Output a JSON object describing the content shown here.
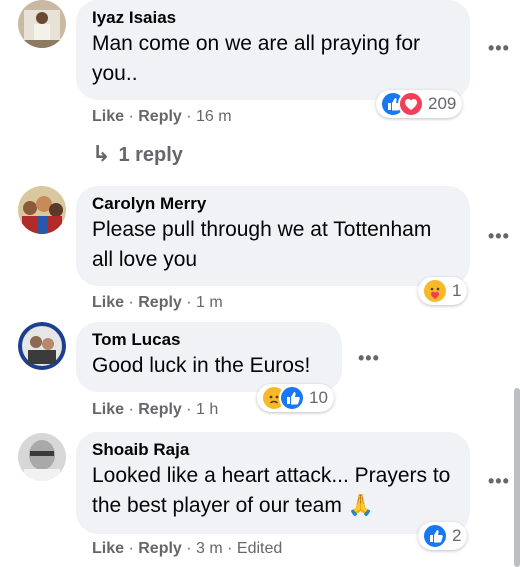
{
  "comments": [
    {
      "author": "Iyaz Isaias",
      "text": "Man come on we are all praying for you..",
      "actions": {
        "like": "Like",
        "sep": " · ",
        "reply": "Reply",
        "time": "16 m"
      },
      "reactions": {
        "icons": [
          "like-icon",
          "love-icon"
        ],
        "count": "209"
      },
      "replies": "1 reply"
    },
    {
      "author": "Carolyn Merry",
      "text": "Please pull through we at Tottenham all love you",
      "actions": {
        "like": "Like",
        "sep": " · ",
        "reply": "Reply",
        "time": "1 m"
      },
      "reactions": {
        "icons": [
          "care-icon"
        ],
        "count": "1"
      }
    },
    {
      "author": "Tom Lucas",
      "text": "Good luck in the Euros!",
      "actions": {
        "like": "Like",
        "sep": " · ",
        "reply": "Reply",
        "time": "1 h"
      },
      "reactions": {
        "icons": [
          "sad-icon",
          "like-icon"
        ],
        "count": "10"
      }
    },
    {
      "author": "Shoaib Raja",
      "text": "Looked like a heart attack... Prayers to the best player of our team 🙏",
      "actions": {
        "like": "Like",
        "sep": " · ",
        "reply": "Reply",
        "time": "3 m",
        "edited": "Edited"
      },
      "reactions": {
        "icons": [
          "like-icon"
        ],
        "count": "2"
      }
    }
  ],
  "colors": {
    "bubble": "#f0f2f5",
    "like": "#1877f2",
    "love": "#f33e58",
    "meta": "#65676b"
  }
}
